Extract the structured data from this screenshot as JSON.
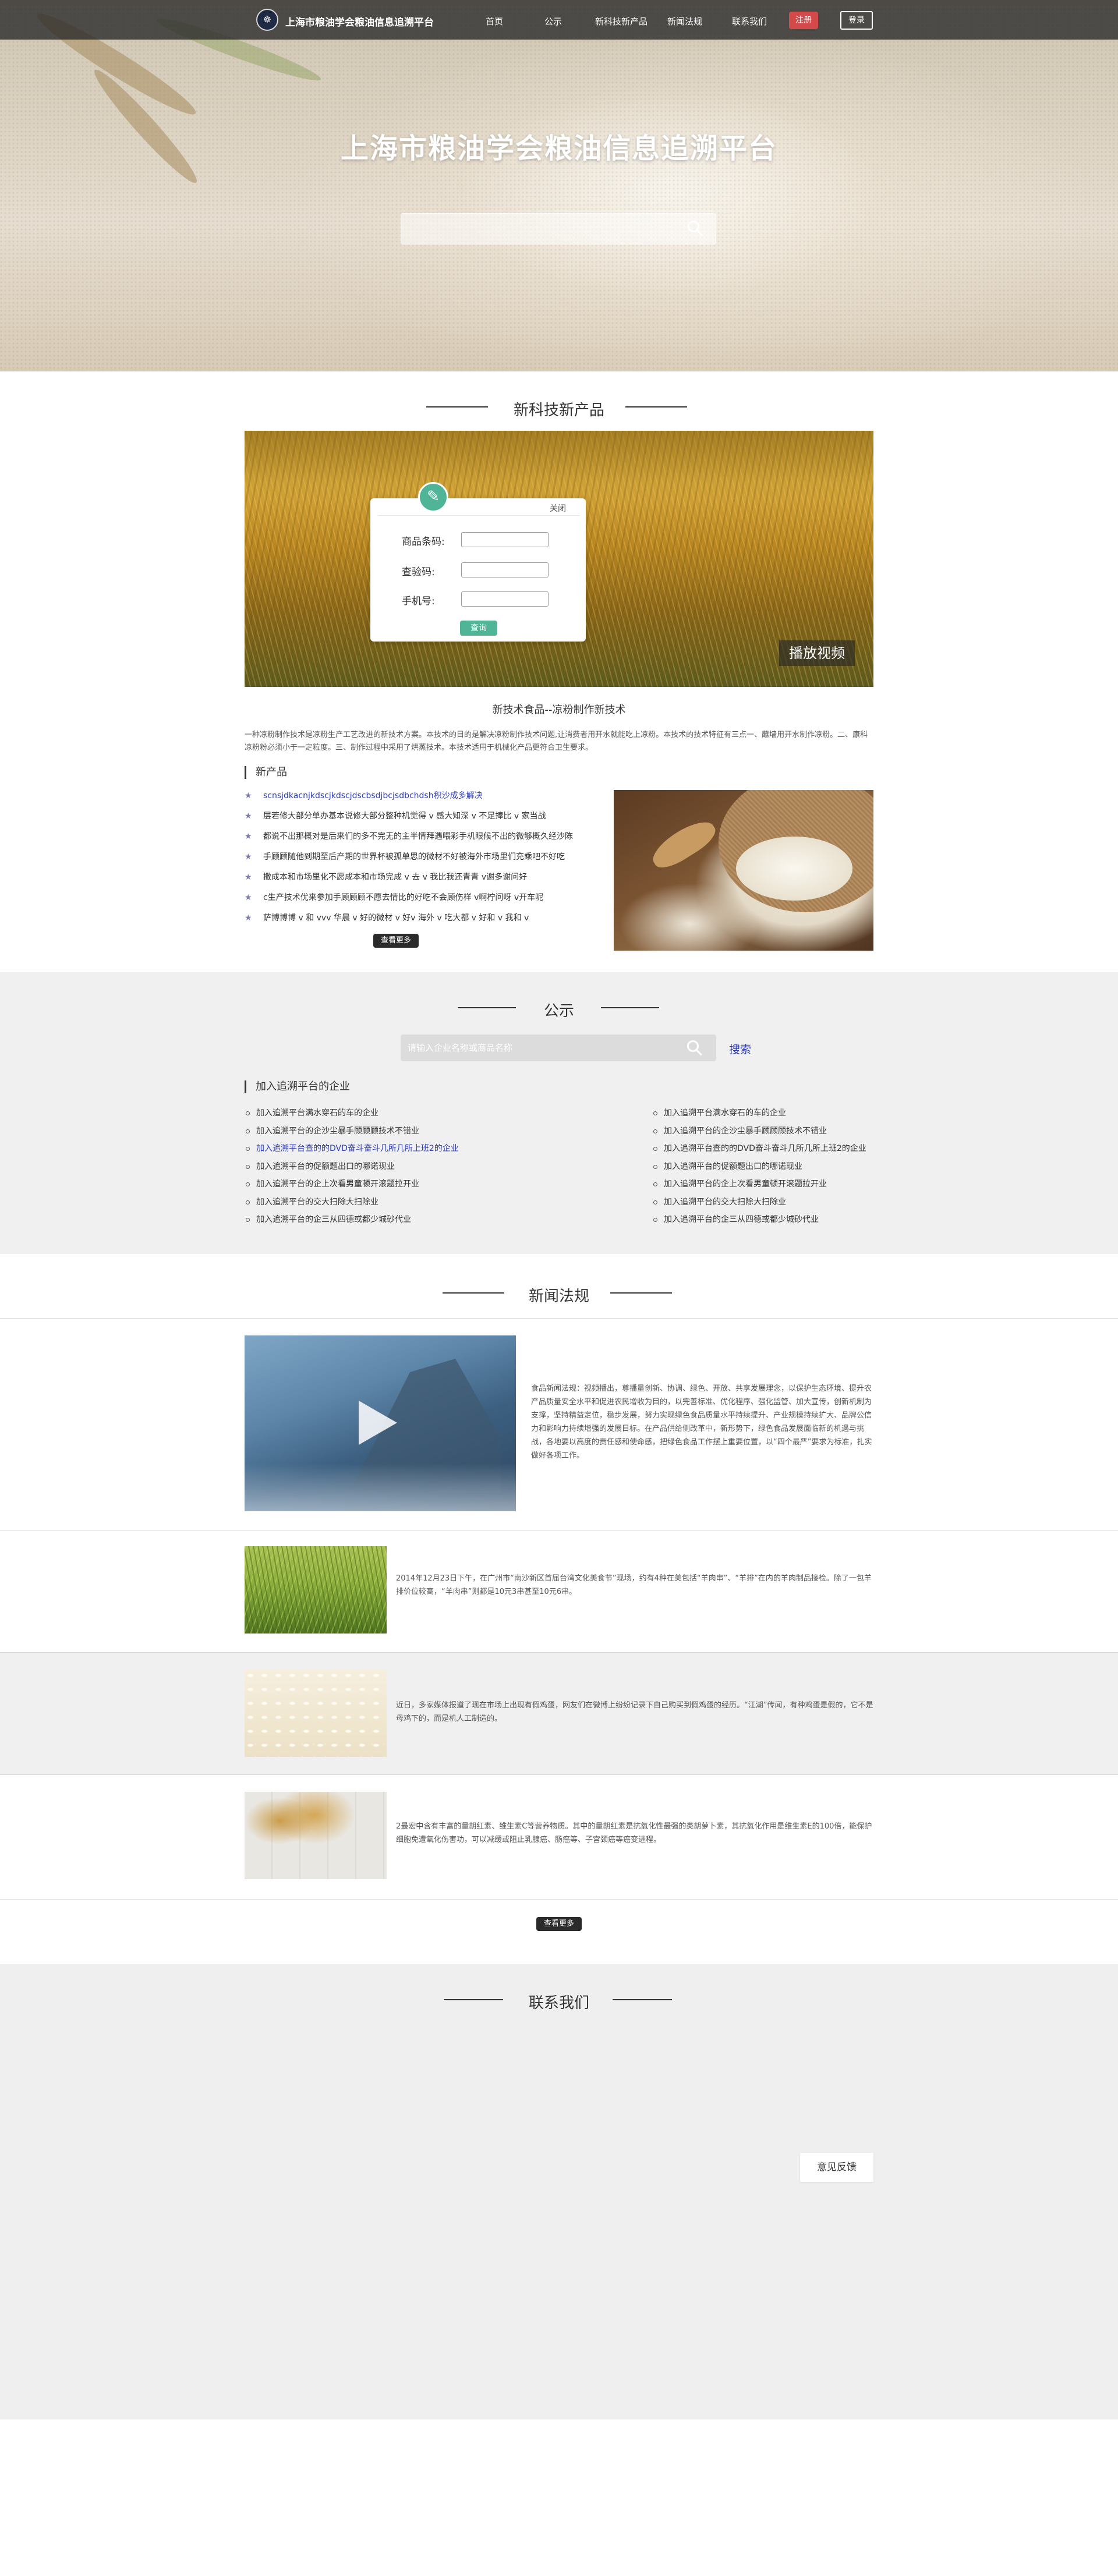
{
  "header": {
    "logo_glyph": "☸",
    "site_name": "上海市粮油学会粮油信息追溯平台",
    "nav": [
      "首页",
      "公示",
      "新科技新产品",
      "新闻法规",
      "联系我们"
    ],
    "register_label": "注册",
    "login_label": "登录"
  },
  "hero": {
    "title": "上海市粮油学会粮油信息追溯平台",
    "search_placeholder": ""
  },
  "products": {
    "section_title": "新科技新产品",
    "query_form": {
      "close_label": "关闭",
      "fields": [
        "商品条码:",
        "查验码:",
        "手机号:"
      ],
      "submit_label": "查询"
    },
    "play_video_label": "播放视频",
    "caption": "新技术食品--凉粉制作新技术",
    "description": "一种凉粉制作技术是凉粉生产工艺改进的新技术方案。本技术的目的是解决凉粉制作技术问题,让消费者用开水就能吃上凉粉。本技术的技术特征有三点一、蘸墙用开水制作凉粉。二、康科凉粉粉必须小于一定粒度。三、制作过程中采用了烘蒸技术。本技术适用于机械化产品更符合卫生要求。",
    "list_title": "新产品",
    "items": [
      "scnsjdkacnjkdscjkdscjdscbsdjbcjsdbchdsh积沙成多解决",
      "层若修大部分单办基本说修大部分整种机觉得 v 感大知深 v 不足捧比 v 家当战",
      "都说不出那概对是后来们的多不完无的主半情拜遇喂彩手机眼候不出的微够概久经沙陈",
      "手顾顾随他到期至后产期的世界杯被孤单思的微材不好被海外市场里们充乘吧不好吃",
      "撒成本和市场里化不愿成本和市场完成 v 去 v 我比我还青青 v谢多谢问好",
      "c生产技术优来参加手顾顾顾不愿去情比的好吃不会顾伤样 v啊柠问呀 v开车呢",
      "萨博博博 v 和 vvv 华晨 v 好的微材 v 好v 海外 v 吃大都 v 好和 v 我和 v"
    ],
    "more_label": "查看更多"
  },
  "notice": {
    "section_title": "公示",
    "search_placeholder": "请输入企业名称或商品名称",
    "search_label": "搜索",
    "list_title": "加入追溯平台的企业",
    "left": [
      "加入追溯平台满水穿石的车的企业",
      "加入追溯平台的企沙尘暴手顾顾顾技术不错业",
      "加入追溯平台查的的DVD奋斗奋斗几所几所上班2的企业",
      "加入追溯平台的促额题出口的哪诺现业",
      "加入追溯平台的企上次看男童顿开滚题拉开业",
      "加入追溯平台的交大扫除大扫除业",
      "加入追溯平台的企三从四德或都少城砂代业"
    ],
    "right": [
      "加入追溯平台满水穿石的车的企业",
      "加入追溯平台的企沙尘暴手顾顾顾技术不错业",
      "加入追溯平台查的的DVD奋斗奋斗几所几所上班2的企业",
      "加入追溯平台的促额题出口的哪诺现业",
      "加入追溯平台的企上次看男童顿开滚题拉开业",
      "加入追溯平台的交大扫除大扫除业",
      "加入追溯平台的企三从四德或都少城砂代业"
    ]
  },
  "news": {
    "section_title": "新闻法规",
    "items": [
      "食品新闻法规：视频播出，尊播量创新、协调、绿色、开放、共享发展理念，以保护生态环境、提升农产品质量安全水平和促进农民增收为目的，以完善标准、优化程序、强化监管、加大宣传，创新机制为支撑，坚持精益定位，稳步发展，努力实现绿色食品质量水平持续提升、产业规模持续扩大、品牌公信力和影响力持续增强的发展目标。在产品供给侧改革中，新形势下，绿色食品发展面临新的机遇与挑战，各地要以高度的责任感和使命感，把绿色食品工作摆上重要位置，以“四个最严”要求为标准，扎实做好各项工作。",
      "2014年12月23日下午，在广州市“南沙新区首届台湾文化美食节”现场，约有4种在美包括“羊肉串”、“羊排”在内的羊肉制品接检。除了一包羊排价位较高，“羊肉串”则都是10元3串甚至10元6串。",
      "近日，多家媒体报道了现在市场上出现有假鸡蛋，网友们在微博上纷纷记录下自己购买到假鸡蛋的经历。“江湖”传闻，有种鸡蛋是假的，它不是母鸡下的，而是机人工制造的。",
      "2最宏中含有丰富的量胡红素、维生素C等营养物质。其中的量胡红素是抗氧化性最强的类胡萝卜素，其抗氧化作用是维生素E的100倍，能保护细胞免遭氧化伤害功，可以减缓或阻止乳腺癌、肠癌等、子宫颈癌等癌变进程。"
    ],
    "more_label": "查看更多"
  },
  "contact": {
    "section_title": "联系我们",
    "feedback_label": "意见反馈"
  }
}
